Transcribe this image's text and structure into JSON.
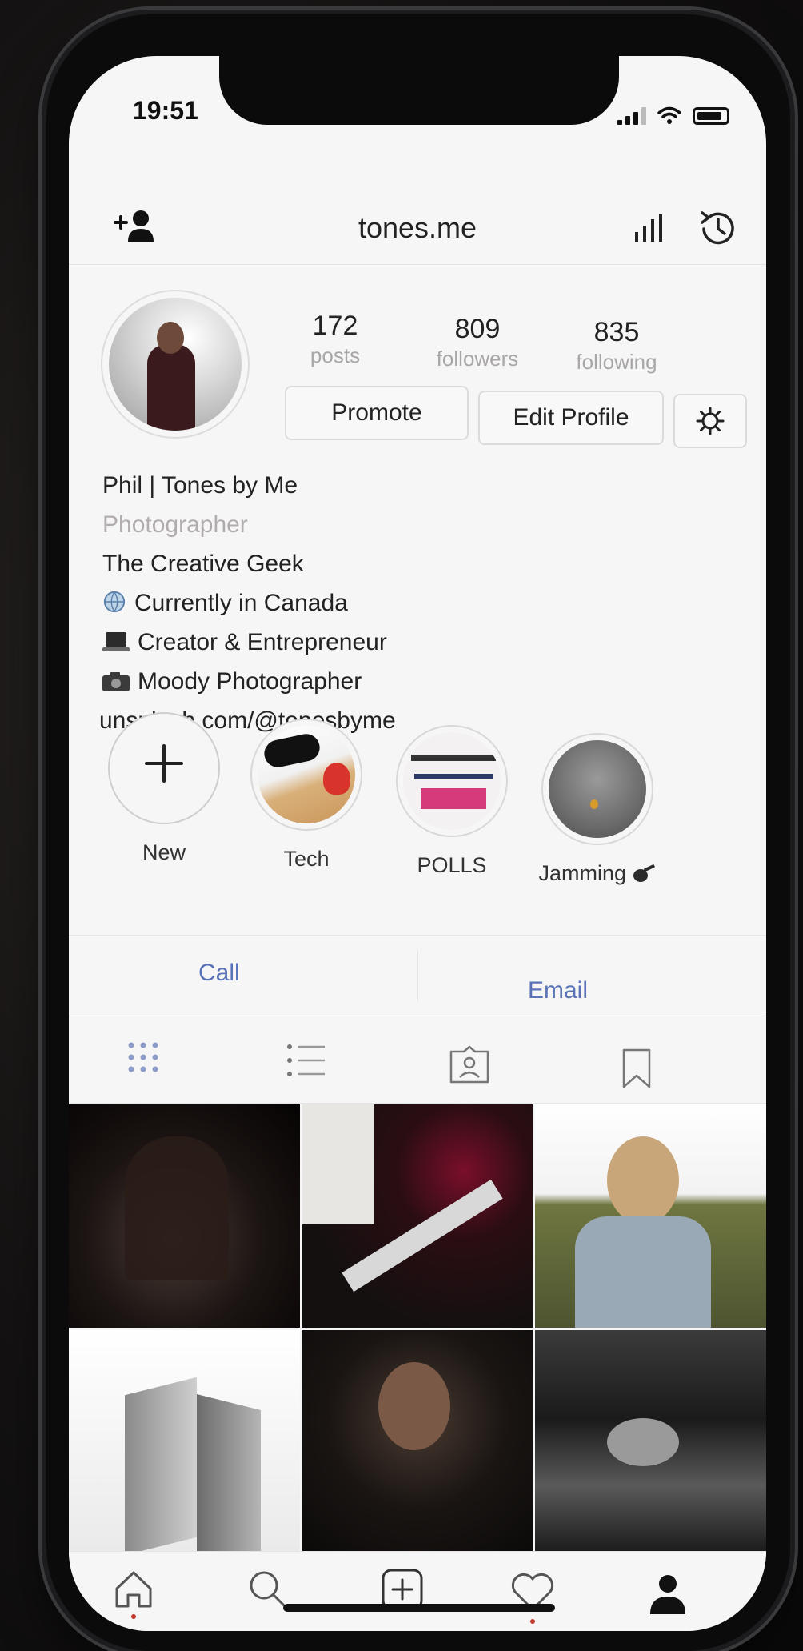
{
  "status": {
    "time": "19:51"
  },
  "header": {
    "username": "tones.me"
  },
  "profile": {
    "stats": [
      {
        "num": "172",
        "label": "posts"
      },
      {
        "num": "809",
        "label": "followers"
      },
      {
        "num": "835",
        "label": "following"
      }
    ],
    "buttons": {
      "promote": "Promote",
      "edit": "Edit Profile"
    },
    "bio": {
      "name": "Phil | Tones by Me",
      "category": "Photographer",
      "lines": [
        "The Creative Geek",
        "Currently in Canada",
        "Creator & Entrepreneur",
        "Moody Photographer"
      ],
      "link": "unsplash.com/@tonesbyme"
    }
  },
  "highlights": [
    {
      "label": "New"
    },
    {
      "label": "Tech"
    },
    {
      "label": "POLLS"
    },
    {
      "label": "Jamming"
    }
  ],
  "contact": {
    "call": "Call",
    "email": "Email"
  },
  "colors": {
    "link": "#5a73b8",
    "accent_dot": "#c0392b",
    "active_tab": "#8c9bc8"
  },
  "icons": {
    "header": [
      "add-user-icon",
      "insights-icon",
      "history-icon"
    ],
    "settings": "gear-icon",
    "tabs": [
      "grid-icon",
      "list-icon",
      "tagged-icon",
      "saved-icon"
    ],
    "nav": [
      "home-icon",
      "search-icon",
      "add-post-icon",
      "activity-icon",
      "profile-icon"
    ]
  }
}
